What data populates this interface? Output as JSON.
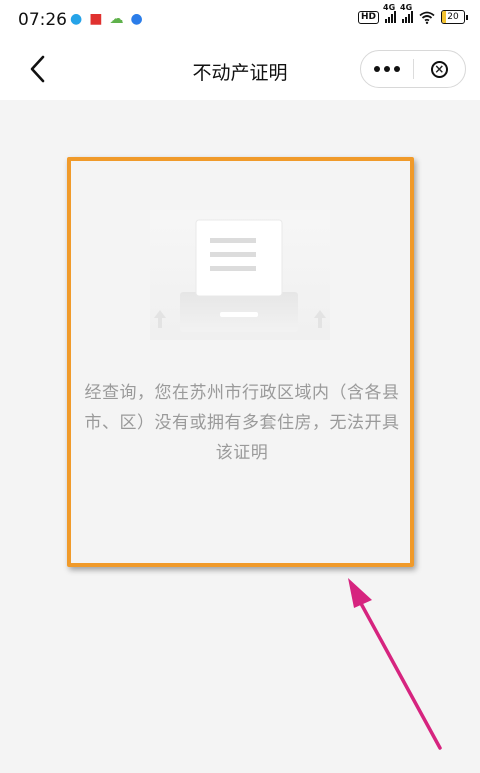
{
  "status_bar": {
    "time": "07:26",
    "notification_icons": [
      "qq-icon",
      "app-red-icon",
      "weather-icon",
      "app-blue-icon"
    ],
    "hd_label": "HD",
    "signal_1_label": "4G",
    "signal_2_label": "4G",
    "battery_level": "20"
  },
  "nav": {
    "title": "不动产证明"
  },
  "empty_state": {
    "message": "经查询，您在苏州市行政区域内（含各县市、区）没有或拥有多套住房，无法开具该证明"
  },
  "colors": {
    "highlight_border": "#f09a2a",
    "annotation_arrow": "#d6247f",
    "message_text": "#9a9a9a"
  }
}
